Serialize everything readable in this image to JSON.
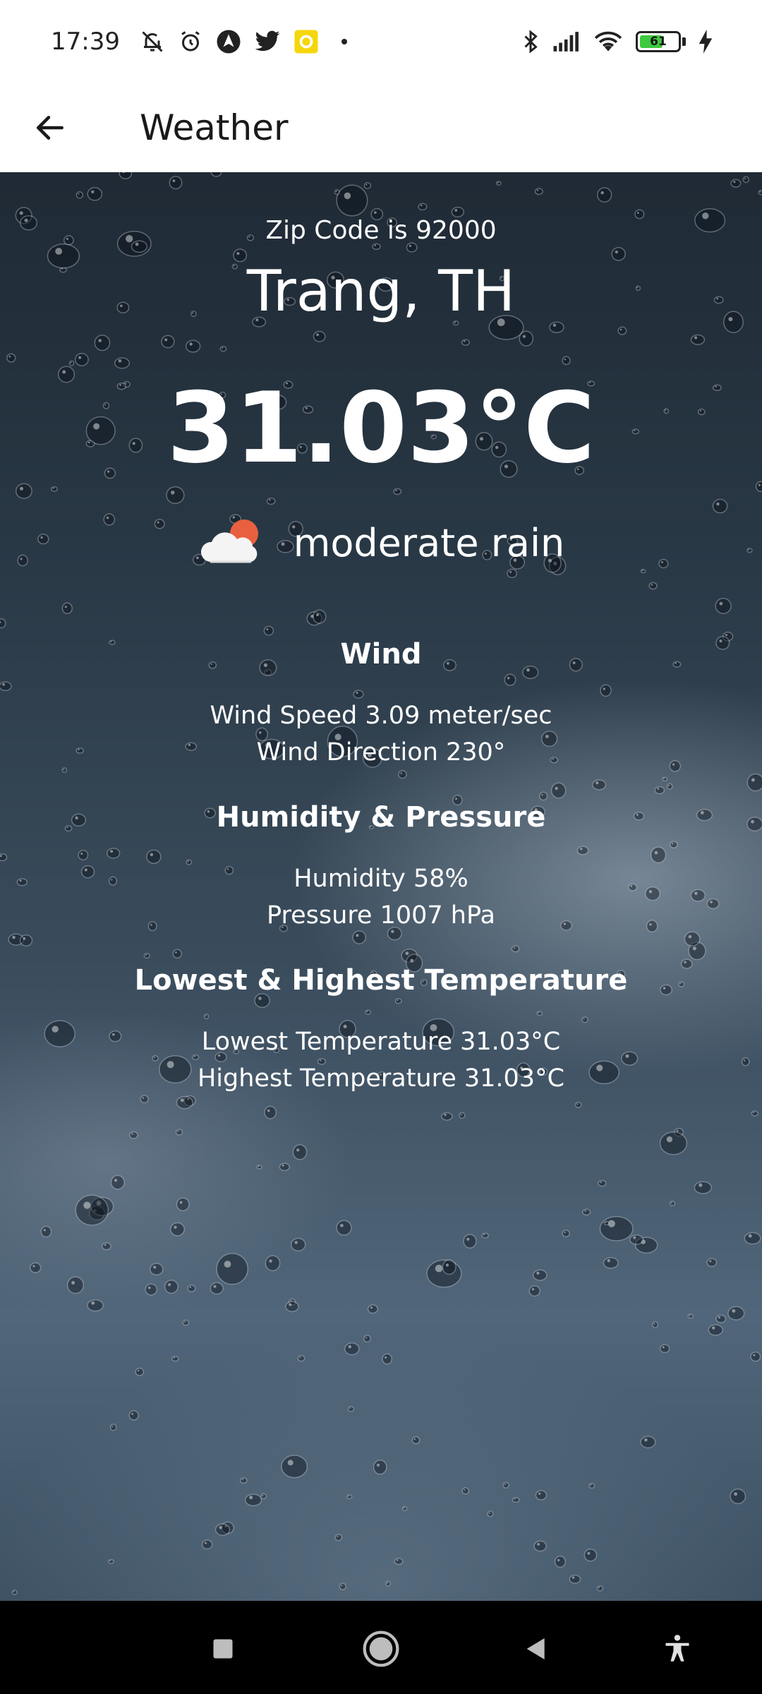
{
  "status_bar": {
    "time": "17:39",
    "icons_left": [
      "mute-icon",
      "alarm-icon",
      "nav-app-icon",
      "twitter-icon",
      "notification-app-icon",
      "more-dot-icon"
    ],
    "icons_right": [
      "bluetooth-icon",
      "signal-icon",
      "wifi-icon",
      "battery-icon",
      "charging-icon"
    ],
    "battery_percent": "61",
    "battery_level": 0.61,
    "battery_color": "#3ec93e"
  },
  "app_bar": {
    "title": "Weather",
    "back_icon": "arrow-left-icon"
  },
  "weather": {
    "zip_line": "Zip Code is 92000",
    "location": "Trang, TH",
    "temperature": "31.03°C",
    "condition": "moderate rain",
    "condition_icon": "cloud-sun-icon"
  },
  "sections": {
    "wind": {
      "title": "Wind",
      "speed": "Wind Speed 3.09 meter/sec",
      "direction": "Wind Direction 230°"
    },
    "humidity_pressure": {
      "title": "Humidity & Pressure",
      "humidity": "Humidity 58%",
      "pressure": "Pressure 1007 hPa"
    },
    "temperature_range": {
      "title": "Lowest & Highest Temperature",
      "lowest": "Lowest Temperature 31.03°C",
      "highest": "Highest Temperature 31.03°C"
    }
  },
  "nav_bar": {
    "buttons": [
      "recents-icon",
      "home-icon",
      "back-icon",
      "accessibility-icon"
    ]
  }
}
